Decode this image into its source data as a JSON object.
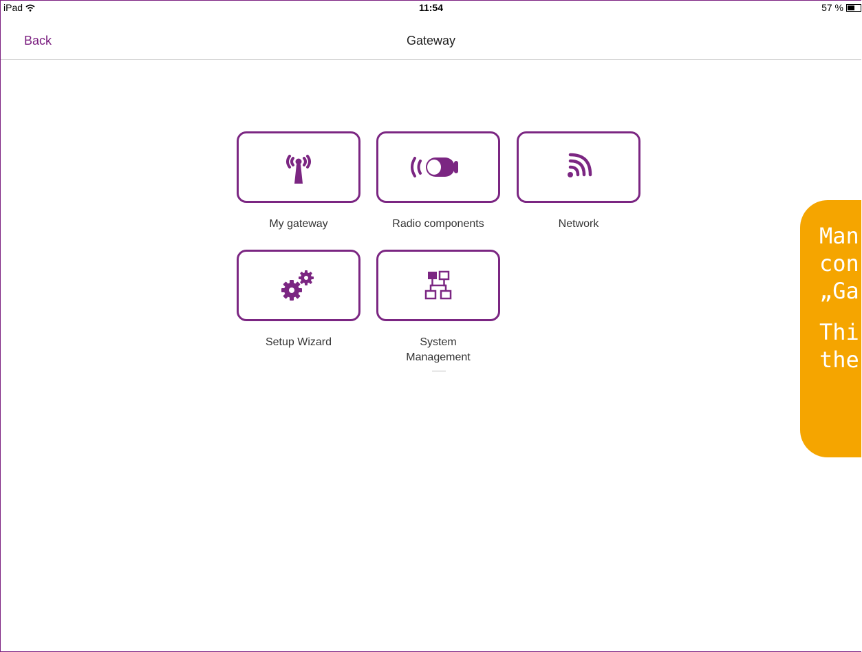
{
  "status_bar": {
    "device": "iPad",
    "time": "11:54",
    "battery": "57 %",
    "battery_level": 0.57
  },
  "nav": {
    "back_label": "Back",
    "title": "Gateway"
  },
  "tiles": [
    {
      "label": "My gateway",
      "icon": "antenna-icon"
    },
    {
      "label": "Radio components",
      "icon": "radio-component-icon"
    },
    {
      "label": "Network",
      "icon": "signal-icon"
    },
    {
      "label": "Setup Wizard",
      "icon": "gears-icon"
    },
    {
      "label": "System\nManagement",
      "icon": "network-hierarchy-icon"
    }
  ],
  "callout": {
    "lines_1": [
      "Man",
      "con",
      "„Ga"
    ],
    "lines_2": [
      "Thi",
      "the"
    ],
    "color": "#f5a500"
  },
  "colors": {
    "accent": "#7b2682"
  }
}
